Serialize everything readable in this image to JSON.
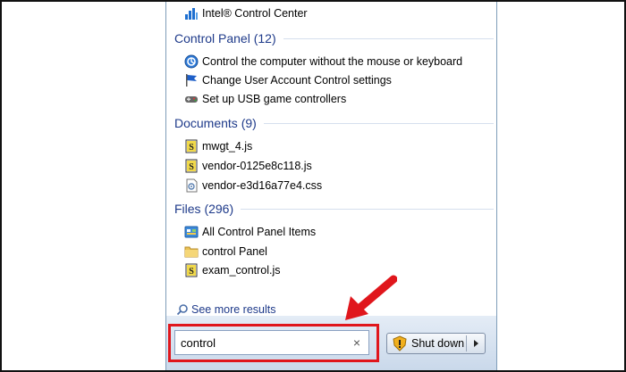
{
  "top_item": {
    "label": "Intel® Control Center",
    "icon": "intel-chart-icon"
  },
  "sections": {
    "control_panel": {
      "title": "Control Panel (12)",
      "items": [
        {
          "label": "Control the computer without the mouse or keyboard",
          "icon": "ease-of-access-icon"
        },
        {
          "label": "Change User Account Control settings",
          "icon": "uac-flag-icon"
        },
        {
          "label": "Set up USB game controllers",
          "icon": "game-controller-icon"
        }
      ]
    },
    "documents": {
      "title": "Documents (9)",
      "items": [
        {
          "label": "mwgt_4.js",
          "icon": "js-file-icon"
        },
        {
          "label": "vendor-0125e8c118.js",
          "icon": "js-file-icon"
        },
        {
          "label": "vendor-e3d16a77e4.css",
          "icon": "css-file-icon"
        }
      ]
    },
    "files": {
      "title": "Files (296)",
      "items": [
        {
          "label": "All Control Panel Items",
          "icon": "control-panel-icon"
        },
        {
          "label": "control Panel",
          "icon": "folder-icon"
        },
        {
          "label": "exam_control.js",
          "icon": "js-file-icon"
        }
      ]
    }
  },
  "see_more": "See more results",
  "search": {
    "value": "control",
    "clear": "×"
  },
  "shutdown": {
    "label": "Shut down"
  },
  "colors": {
    "heading": "#1e3a8a",
    "highlight": "#e0161c"
  }
}
